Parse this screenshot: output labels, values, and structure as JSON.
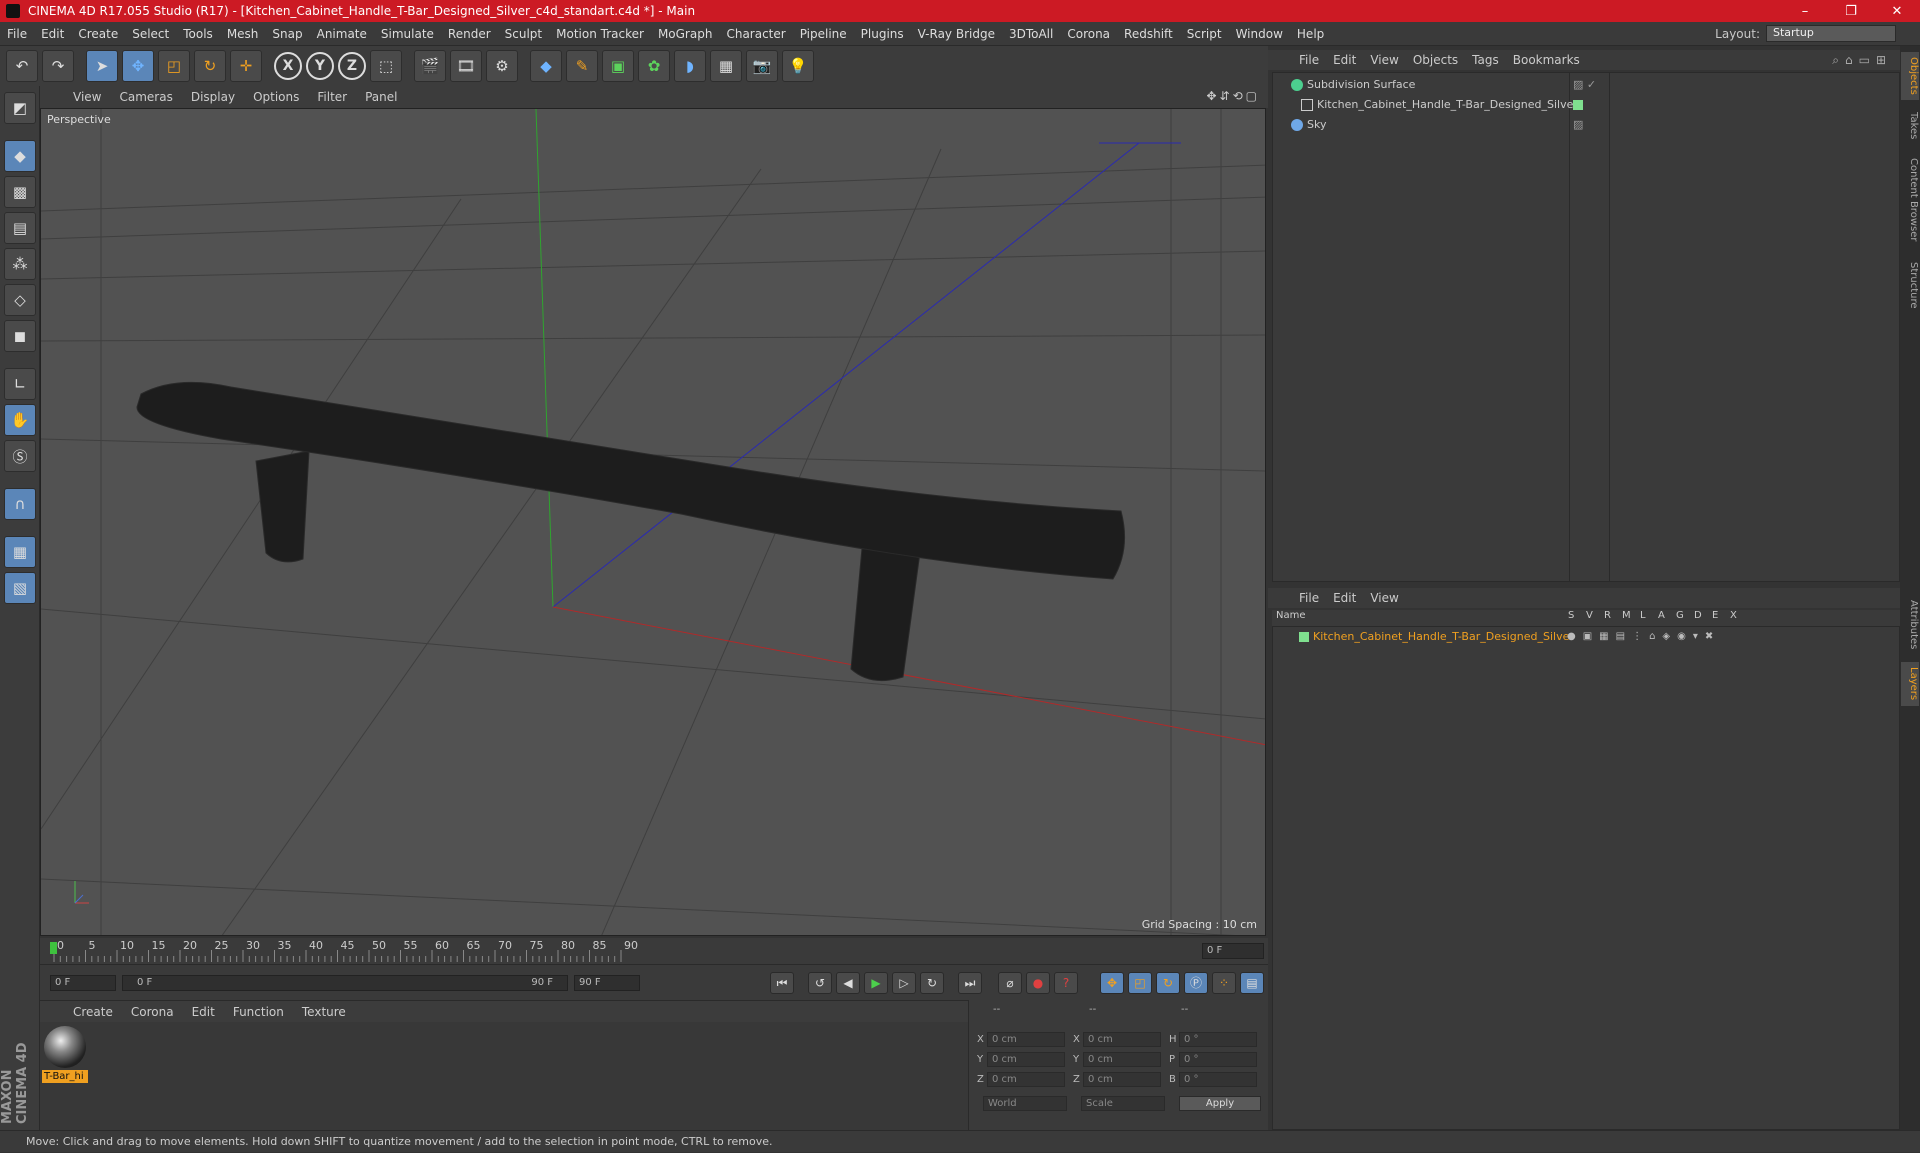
{
  "window": {
    "title": "CINEMA 4D R17.055 Studio (R17) - [Kitchen_Cabinet_Handle_T-Bar_Designed_Silver_c4d_standart.c4d *] - Main",
    "minimize": "–",
    "maximize": "❐",
    "close": "✕"
  },
  "menubar": {
    "items": [
      "File",
      "Edit",
      "Create",
      "Select",
      "Tools",
      "Mesh",
      "Snap",
      "Animate",
      "Simulate",
      "Render",
      "Sculpt",
      "Motion Tracker",
      "MoGraph",
      "Character",
      "Pipeline",
      "Plugins",
      "V-Ray Bridge",
      "3DToAll",
      "Corona",
      "Redshift",
      "Script",
      "Window",
      "Help"
    ],
    "layout_label": "Layout:",
    "layout_value": "Startup"
  },
  "viewport": {
    "menu": [
      "View",
      "Cameras",
      "Display",
      "Options",
      "Filter",
      "Panel"
    ],
    "name": "Perspective",
    "grid_spacing": "Grid Spacing : 10 cm"
  },
  "timeline": {
    "ticks": [
      "0",
      "5",
      "10",
      "15",
      "20",
      "25",
      "30",
      "35",
      "40",
      "45",
      "50",
      "55",
      "60",
      "65",
      "70",
      "75",
      "80",
      "85",
      "90"
    ],
    "current_frame": "0 F",
    "start_field": "0 F",
    "range_start": "0 F",
    "range_end": "90 F",
    "end_field": "90 F"
  },
  "material_panel": {
    "menu": [
      "Create",
      "Corona",
      "Edit",
      "Function",
      "Texture"
    ],
    "material_name": "T-Bar_hi"
  },
  "coords": {
    "header": [
      "--",
      "--",
      "--"
    ],
    "labels_left": [
      "X",
      "Y",
      "Z"
    ],
    "labels_mid": [
      "X",
      "Y",
      "Z"
    ],
    "labels_right": [
      "H",
      "P",
      "B"
    ],
    "pos_values": [
      "0 cm",
      "0 cm",
      "0 cm"
    ],
    "size_values": [
      "0 cm",
      "0 cm",
      "0 cm"
    ],
    "rot_values": [
      "0 °",
      "0 °",
      "0 °"
    ],
    "mode_select": "World",
    "scale_select": "Scale",
    "apply": "Apply"
  },
  "object_manager": {
    "menu": [
      "File",
      "Edit",
      "View",
      "Objects",
      "Tags",
      "Bookmarks"
    ],
    "objects": [
      {
        "name": "Subdivision Surface"
      },
      {
        "name": "Kitchen_Cabinet_Handle_T-Bar_Designed_Silver"
      },
      {
        "name": "Sky"
      }
    ]
  },
  "layer_manager": {
    "menu": [
      "File",
      "Edit",
      "View"
    ],
    "columns": [
      "Name",
      "S",
      "V",
      "R",
      "M",
      "L",
      "A",
      "G",
      "D",
      "E",
      "X"
    ],
    "layer_name": "Kitchen_Cabinet_Handle_T-Bar_Designed_Silver"
  },
  "side_tabs": [
    "Objects",
    "Takes",
    "Content Browser",
    "Structure",
    "Attributes",
    "Layers"
  ],
  "statusbar": "Move: Click and drag to move elements. Hold down SHIFT to quantize movement / add to the selection in point mode, CTRL to remove.",
  "brand": "MAXON CINEMA 4D",
  "colors": {
    "title_bar": "#cc1a24",
    "accent_orange": "#f0a020",
    "selected_blue": "#5b86b8"
  }
}
